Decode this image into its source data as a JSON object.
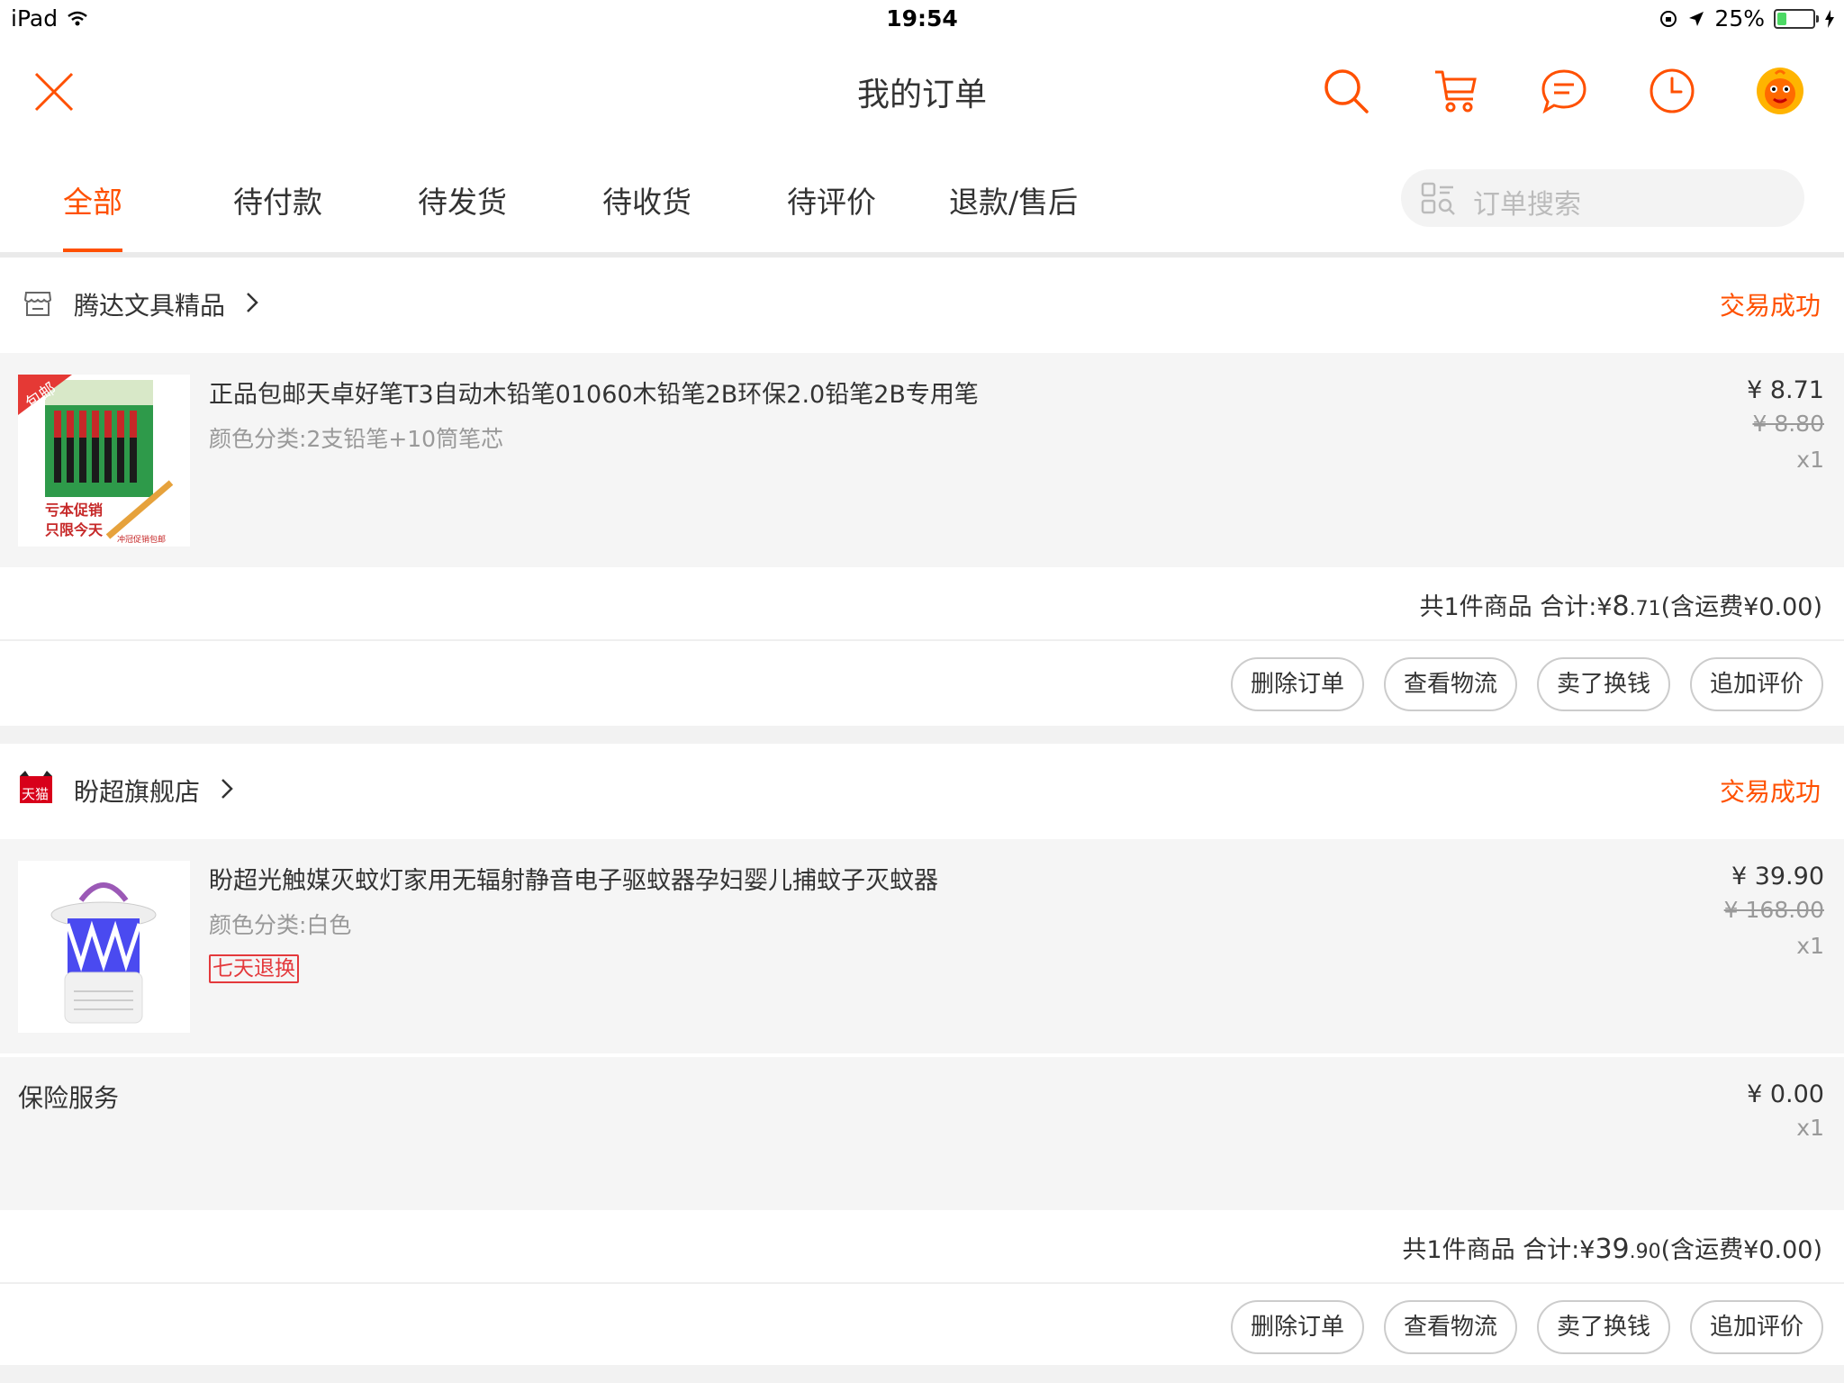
{
  "status_bar": {
    "device": "iPad",
    "time": "19:54",
    "battery": "25%",
    "battery_level": 0.25
  },
  "header": {
    "title": "我的订单",
    "icons": [
      "close-icon",
      "search-icon",
      "cart-icon",
      "message-icon",
      "history-icon",
      "avatar"
    ]
  },
  "tabs": [
    "全部",
    "待付款",
    "待发货",
    "待收货",
    "待评价",
    "退款/售后"
  ],
  "active_tab": "全部",
  "search": {
    "placeholder": "订单搜索"
  },
  "colors": {
    "accent": "#ff5000",
    "badge": "#e4393c",
    "battery": "#4cd964"
  },
  "orders": [
    {
      "shop": "腾达文具精品",
      "shop_icon": "store-icon",
      "status": "交易成功",
      "item": {
        "title": "正品包邮天卓好笔T3自动木铅笔01060木铅笔2B环保2.0铅笔2B专用笔",
        "sku": "颜色分类:2支铅笔+10筒笔芯",
        "price": "¥ 8.71",
        "original_price": "¥ 8.80",
        "qty": "x1",
        "image_text": {
          "corner": "包邮",
          "promo1": "亏本促销",
          "promo2": "只限今天",
          "promo3": "冲冠促销包邮"
        }
      },
      "summary": {
        "prefix": "共1件商品 合计:",
        "currency": "¥",
        "int": "8",
        "dec": ".71",
        "suffix": "(含运费¥0.00)"
      },
      "actions": [
        "删除订单",
        "查看物流",
        "卖了换钱",
        "追加评价"
      ]
    },
    {
      "shop": "盼超旗舰店",
      "shop_icon": "tmall-icon",
      "shop_icon_text": "天猫",
      "status": "交易成功",
      "item": {
        "title": "盼超光触媒灭蚊灯家用无辐射静音电子驱蚊器孕妇婴儿捕蚊子灭蚊器",
        "sku": "颜色分类:白色",
        "badge": "七天退换",
        "price": "¥ 39.90",
        "original_price": "¥ 168.00",
        "qty": "x1"
      },
      "service": {
        "name": "保险服务",
        "price": "¥ 0.00",
        "qty": "x1"
      },
      "summary": {
        "prefix": "共1件商品 合计:",
        "currency": "¥",
        "int": "39",
        "dec": ".90",
        "suffix": "(含运费¥0.00)"
      },
      "actions": [
        "删除订单",
        "查看物流",
        "卖了换钱",
        "追加评价"
      ]
    }
  ]
}
